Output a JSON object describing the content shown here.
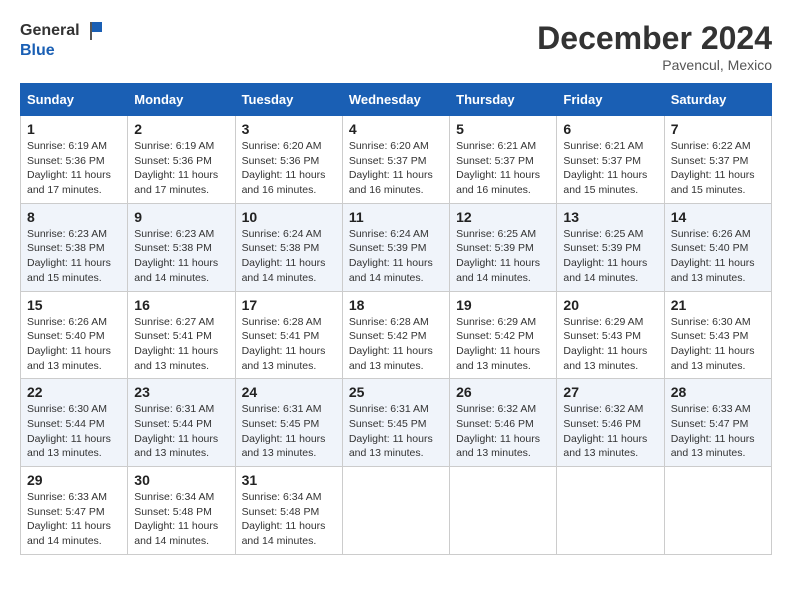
{
  "logo": {
    "line1": "General",
    "line2": "Blue"
  },
  "title": "December 2024",
  "location": "Pavencul, Mexico",
  "weekdays": [
    "Sunday",
    "Monday",
    "Tuesday",
    "Wednesday",
    "Thursday",
    "Friday",
    "Saturday"
  ],
  "weeks": [
    [
      {
        "day": "1",
        "sunrise": "6:19 AM",
        "sunset": "5:36 PM",
        "daylight": "11 hours and 17 minutes."
      },
      {
        "day": "2",
        "sunrise": "6:19 AM",
        "sunset": "5:36 PM",
        "daylight": "11 hours and 17 minutes."
      },
      {
        "day": "3",
        "sunrise": "6:20 AM",
        "sunset": "5:36 PM",
        "daylight": "11 hours and 16 minutes."
      },
      {
        "day": "4",
        "sunrise": "6:20 AM",
        "sunset": "5:37 PM",
        "daylight": "11 hours and 16 minutes."
      },
      {
        "day": "5",
        "sunrise": "6:21 AM",
        "sunset": "5:37 PM",
        "daylight": "11 hours and 16 minutes."
      },
      {
        "day": "6",
        "sunrise": "6:21 AM",
        "sunset": "5:37 PM",
        "daylight": "11 hours and 15 minutes."
      },
      {
        "day": "7",
        "sunrise": "6:22 AM",
        "sunset": "5:37 PM",
        "daylight": "11 hours and 15 minutes."
      }
    ],
    [
      {
        "day": "8",
        "sunrise": "6:23 AM",
        "sunset": "5:38 PM",
        "daylight": "11 hours and 15 minutes."
      },
      {
        "day": "9",
        "sunrise": "6:23 AM",
        "sunset": "5:38 PM",
        "daylight": "11 hours and 14 minutes."
      },
      {
        "day": "10",
        "sunrise": "6:24 AM",
        "sunset": "5:38 PM",
        "daylight": "11 hours and 14 minutes."
      },
      {
        "day": "11",
        "sunrise": "6:24 AM",
        "sunset": "5:39 PM",
        "daylight": "11 hours and 14 minutes."
      },
      {
        "day": "12",
        "sunrise": "6:25 AM",
        "sunset": "5:39 PM",
        "daylight": "11 hours and 14 minutes."
      },
      {
        "day": "13",
        "sunrise": "6:25 AM",
        "sunset": "5:39 PM",
        "daylight": "11 hours and 14 minutes."
      },
      {
        "day": "14",
        "sunrise": "6:26 AM",
        "sunset": "5:40 PM",
        "daylight": "11 hours and 13 minutes."
      }
    ],
    [
      {
        "day": "15",
        "sunrise": "6:26 AM",
        "sunset": "5:40 PM",
        "daylight": "11 hours and 13 minutes."
      },
      {
        "day": "16",
        "sunrise": "6:27 AM",
        "sunset": "5:41 PM",
        "daylight": "11 hours and 13 minutes."
      },
      {
        "day": "17",
        "sunrise": "6:28 AM",
        "sunset": "5:41 PM",
        "daylight": "11 hours and 13 minutes."
      },
      {
        "day": "18",
        "sunrise": "6:28 AM",
        "sunset": "5:42 PM",
        "daylight": "11 hours and 13 minutes."
      },
      {
        "day": "19",
        "sunrise": "6:29 AM",
        "sunset": "5:42 PM",
        "daylight": "11 hours and 13 minutes."
      },
      {
        "day": "20",
        "sunrise": "6:29 AM",
        "sunset": "5:43 PM",
        "daylight": "11 hours and 13 minutes."
      },
      {
        "day": "21",
        "sunrise": "6:30 AM",
        "sunset": "5:43 PM",
        "daylight": "11 hours and 13 minutes."
      }
    ],
    [
      {
        "day": "22",
        "sunrise": "6:30 AM",
        "sunset": "5:44 PM",
        "daylight": "11 hours and 13 minutes."
      },
      {
        "day": "23",
        "sunrise": "6:31 AM",
        "sunset": "5:44 PM",
        "daylight": "11 hours and 13 minutes."
      },
      {
        "day": "24",
        "sunrise": "6:31 AM",
        "sunset": "5:45 PM",
        "daylight": "11 hours and 13 minutes."
      },
      {
        "day": "25",
        "sunrise": "6:31 AM",
        "sunset": "5:45 PM",
        "daylight": "11 hours and 13 minutes."
      },
      {
        "day": "26",
        "sunrise": "6:32 AM",
        "sunset": "5:46 PM",
        "daylight": "11 hours and 13 minutes."
      },
      {
        "day": "27",
        "sunrise": "6:32 AM",
        "sunset": "5:46 PM",
        "daylight": "11 hours and 13 minutes."
      },
      {
        "day": "28",
        "sunrise": "6:33 AM",
        "sunset": "5:47 PM",
        "daylight": "11 hours and 13 minutes."
      }
    ],
    [
      {
        "day": "29",
        "sunrise": "6:33 AM",
        "sunset": "5:47 PM",
        "daylight": "11 hours and 14 minutes."
      },
      {
        "day": "30",
        "sunrise": "6:34 AM",
        "sunset": "5:48 PM",
        "daylight": "11 hours and 14 minutes."
      },
      {
        "day": "31",
        "sunrise": "6:34 AM",
        "sunset": "5:48 PM",
        "daylight": "11 hours and 14 minutes."
      },
      null,
      null,
      null,
      null
    ]
  ]
}
